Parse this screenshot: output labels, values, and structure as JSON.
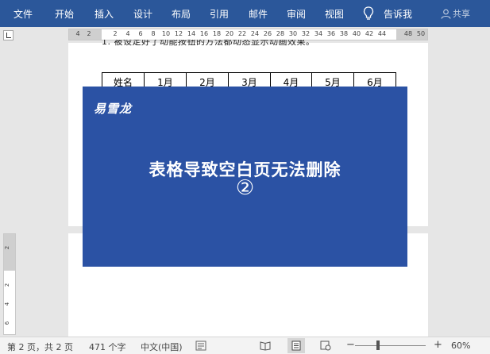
{
  "ribbon": {
    "tabs": [
      "文件",
      "开始",
      "插入",
      "设计",
      "布局",
      "引用",
      "邮件",
      "审阅",
      "视图"
    ],
    "tell_me": "告诉我",
    "share": "共享"
  },
  "ruler": {
    "numbers": [
      "4",
      "2",
      "2",
      "4",
      "6",
      "8",
      "10",
      "12",
      "14",
      "16",
      "18",
      "20",
      "22",
      "24",
      "26",
      "28",
      "30",
      "32",
      "34",
      "36",
      "38",
      "40",
      "42",
      "44",
      "48",
      "50"
    ]
  },
  "vruler": {
    "numbers": [
      "2",
      "2",
      "4",
      "6"
    ]
  },
  "document": {
    "cut_text": "1. 被设定好了动能按钮的方法都动态显示动画效果。",
    "table_headers": [
      "姓名",
      "1月",
      "2月",
      "3月",
      "4月",
      "5月",
      "6月"
    ]
  },
  "card": {
    "brand": "易雪龙",
    "headline": "表格导致空白页无法删除",
    "number": "②",
    "bg_color": "#2b52a4"
  },
  "status": {
    "page": "第 2 页，共 2 页",
    "words": "471 个字",
    "language": "中文(中国)",
    "zoom": "60%",
    "zoom_minus": "−",
    "zoom_plus": "+"
  },
  "colors": {
    "ribbon": "#2b579a",
    "status_bg": "#f3f3f3"
  }
}
